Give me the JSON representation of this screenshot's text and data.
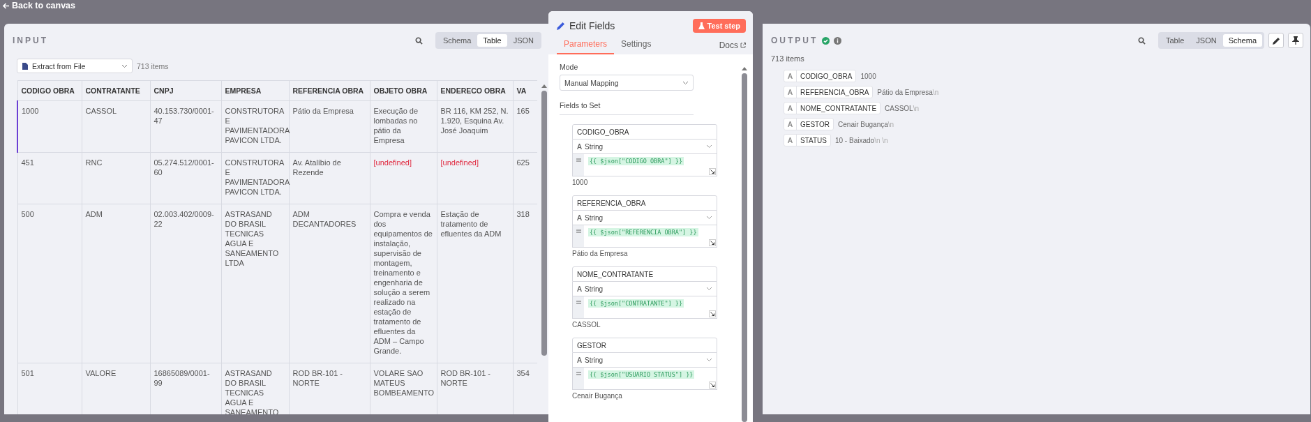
{
  "top_bar": {
    "back_link": "Back to canvas"
  },
  "input": {
    "title": "INPUT",
    "view_modes": [
      {
        "label": "Schema",
        "selected": false
      },
      {
        "label": "Table",
        "selected": true
      },
      {
        "label": "JSON",
        "selected": false
      }
    ],
    "source_select": "Extract from File",
    "item_count": "713 items",
    "table": {
      "columns": [
        "CODIGO OBRA",
        "CONTRATANTE",
        "CNPJ",
        "EMPRESA",
        "REFERENCIA OBRA",
        "OBJETO OBRA",
        "ENDERECO OBRA",
        "VA"
      ],
      "rows": [
        {
          "selected": true,
          "cells": [
            {
              "text": "1000",
              "kind": "value"
            },
            {
              "text": "CASSOL",
              "kind": "value"
            },
            {
              "text": "40.153.730/0001-47",
              "kind": "value"
            },
            {
              "text": "CONSTRUTORA E PAVIMENTADORA PAVICON LTDA.",
              "kind": "value"
            },
            {
              "text": "Pátio da Empresa",
              "kind": "value"
            },
            {
              "text": "Execução de lombadas no pátio da Empresa",
              "kind": "value"
            },
            {
              "text": "BR 116, KM 252, N. 1.920, Esquina Av. José Joaquim",
              "kind": "value"
            },
            {
              "text": "165",
              "kind": "value"
            }
          ]
        },
        {
          "selected": false,
          "cells": [
            {
              "text": "451",
              "kind": "value"
            },
            {
              "text": "RNC",
              "kind": "value"
            },
            {
              "text": "05.274.512/0001-60",
              "kind": "value"
            },
            {
              "text": "CONSTRUTORA E PAVIMENTADORA PAVICON LTDA.",
              "kind": "value"
            },
            {
              "text": "Av. Atalíbio de Rezende",
              "kind": "value"
            },
            {
              "text": "[undefined]",
              "kind": "undefined"
            },
            {
              "text": "[undefined]",
              "kind": "undefined"
            },
            {
              "text": "625",
              "kind": "value"
            }
          ]
        },
        {
          "selected": false,
          "cells": [
            {
              "text": "500",
              "kind": "value"
            },
            {
              "text": "ADM",
              "kind": "value"
            },
            {
              "text": "02.003.402/0009-22",
              "kind": "value"
            },
            {
              "text": "ASTRASAND DO BRASIL TECNICAS AGUA E SANEAMENTO LTDA",
              "kind": "value"
            },
            {
              "text": "ADM DECANTADORES",
              "kind": "value"
            },
            {
              "text": "Compra e venda dos equipamentos de instalação, supervisão de montagem, treinamento e engenharia de solução a serem realizado na estação de tratamento de efluentes da ADM – Campo Grande.",
              "kind": "value"
            },
            {
              "text": "Estação de tratamento de efluentes da ADM",
              "kind": "value"
            },
            {
              "text": "318",
              "kind": "value"
            }
          ]
        },
        {
          "selected": false,
          "cells": [
            {
              "text": "501",
              "kind": "value"
            },
            {
              "text": "VALORE",
              "kind": "value"
            },
            {
              "text": "16865089/0001-99",
              "kind": "value"
            },
            {
              "text": "ASTRASAND DO BRASIL TECNICAS AGUA E SANEAMENTO",
              "kind": "value"
            },
            {
              "text": "ROD BR-101 - NORTE",
              "kind": "value"
            },
            {
              "text": "VOLARE SAO MATEUS BOMBEAMENTO",
              "kind": "value"
            },
            {
              "text": "ROD BR-101 - NORTE",
              "kind": "value"
            },
            {
              "text": "354",
              "kind": "value"
            }
          ]
        }
      ]
    }
  },
  "node": {
    "title": "Edit Fields",
    "test_button": "Test step",
    "tabs": [
      {
        "label": "Parameters",
        "selected": true
      },
      {
        "label": "Settings",
        "selected": false
      }
    ],
    "docs_link": "Docs",
    "mode": {
      "label": "Mode",
      "value": "Manual Mapping"
    },
    "fields_label": "Fields to Set",
    "fields": [
      {
        "name": "CODIGO_OBRA",
        "type": "String",
        "expression": "{{ $json[\"CODIGO OBRA\"] }}",
        "preview": "1000"
      },
      {
        "name": "REFERENCIA_OBRA",
        "type": "String",
        "expression": "{{ $json[\"REFERENCIA OBRA\"] }}",
        "preview": "Pátio da Empresa"
      },
      {
        "name": "NOME_CONTRATANTE",
        "type": "String",
        "expression": "{{ $json[\"CONTRATANTE\"] }}",
        "preview": "CASSOL"
      },
      {
        "name": "GESTOR",
        "type": "String",
        "expression": "{{ $json[\"USUARIO STATUS\"] }}",
        "preview": "Cenair Bugança"
      }
    ]
  },
  "output": {
    "title": "OUTPUT",
    "view_modes": [
      {
        "label": "Table",
        "selected": false
      },
      {
        "label": "JSON",
        "selected": false
      },
      {
        "label": "Schema",
        "selected": true
      }
    ],
    "item_count": "713 items",
    "schema": [
      {
        "key": "CODIGO_OBRA",
        "value": "1000"
      },
      {
        "key": "REFERENCIA_OBRA",
        "value": "Pátio da Empresa",
        "suffix": "\\n"
      },
      {
        "key": "NOME_CONTRATANTE",
        "value": "CASSOL",
        "suffix": "\\n"
      },
      {
        "key": "GESTOR",
        "value": "Cenair Bugança",
        "suffix": "\\n"
      },
      {
        "key": "STATUS",
        "value": "10 - Baixado",
        "suffix": "\\n \\n"
      }
    ]
  }
}
